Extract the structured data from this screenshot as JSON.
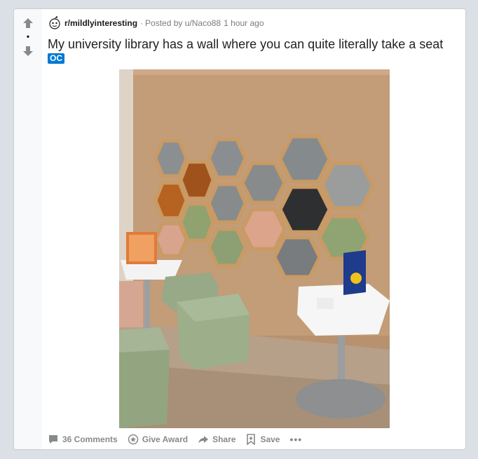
{
  "post": {
    "subreddit": "r/mildlyinteresting",
    "meta_sep": "·",
    "posted_by": "Posted by u/Naco88",
    "age": "1 hour ago",
    "title": "My university library has a wall where you can quite literally take a seat",
    "flair": "OC",
    "score": "•"
  },
  "actions": {
    "comments": "36 Comments",
    "award": "Give Award",
    "share": "Share",
    "save": "Save",
    "more": "•••"
  },
  "colors": {
    "flair_bg": "#0079d3",
    "page_bg": "#dae0e6",
    "vote_column": "#f8f9fa",
    "meta_text": "#787c7e"
  },
  "icons": [
    "upvote-arrow-icon",
    "downvote-arrow-icon",
    "subreddit-icon",
    "comment-icon",
    "award-icon",
    "share-icon",
    "save-icon",
    "more-icon"
  ]
}
